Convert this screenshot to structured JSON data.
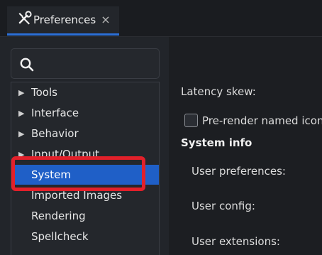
{
  "tab": {
    "title": "Preferences",
    "close_glyph": "×",
    "icon": "tools-icon"
  },
  "search": {
    "icon": "search-icon",
    "value": "",
    "placeholder": ""
  },
  "tree": {
    "items": [
      {
        "label": "Tools",
        "expandable": true
      },
      {
        "label": "Interface",
        "expandable": true
      },
      {
        "label": "Behavior",
        "expandable": true
      },
      {
        "label": "Input/Output",
        "expandable": true
      },
      {
        "label": "System",
        "expandable": false,
        "selected": true
      },
      {
        "label": "Imported Images",
        "expandable": false
      },
      {
        "label": "Rendering",
        "expandable": false
      },
      {
        "label": "Spellcheck",
        "expandable": false
      }
    ]
  },
  "content": {
    "latency_label": "Latency skew:",
    "prerender_label": "Pre-render named icons",
    "prerender_checked": false,
    "system_info_title": "System info",
    "user_preferences_label": "User preferences:",
    "user_config_label": "User config:",
    "user_extensions_label": "User extensions:"
  },
  "colors": {
    "selection": "#1f5fc7",
    "highlight": "#e2202a",
    "tab_accent": "#2b6fd6"
  }
}
